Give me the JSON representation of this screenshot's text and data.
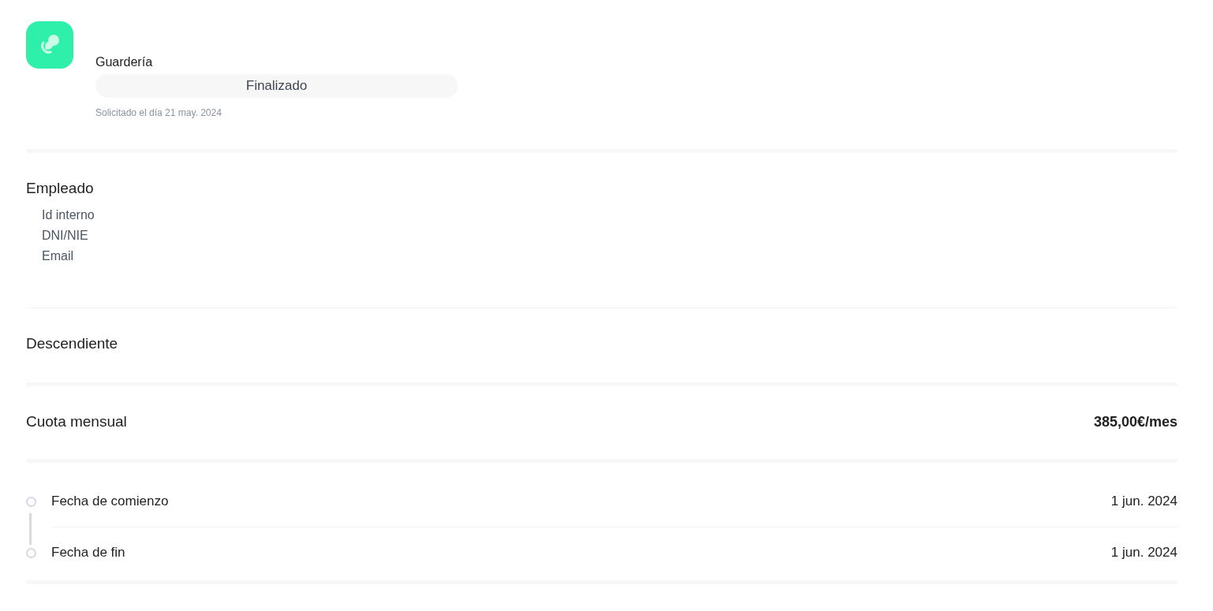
{
  "header": {
    "title": "Guardería",
    "status": "Finalizado",
    "requested": "Solicitado el día 21 may. 2024"
  },
  "employee": {
    "heading": "Empleado",
    "fields": [
      "Id interno",
      "DNI/NIE",
      "Email"
    ]
  },
  "descendant": {
    "heading": "Descendiente"
  },
  "fee": {
    "label": "Cuota mensual",
    "value": "385,00€/mes"
  },
  "dates": [
    {
      "label": "Fecha de comienzo",
      "value": "1 jun. 2024"
    },
    {
      "label": "Fecha de fin",
      "value": "1 jun. 2024"
    }
  ]
}
